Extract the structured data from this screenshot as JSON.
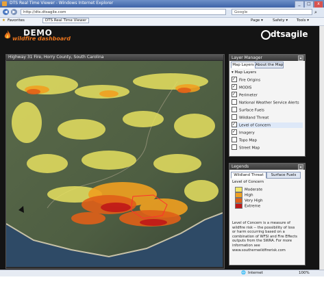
{
  "window": {
    "title": "DTS Real Time Viewer - Windows Internet Explorer",
    "controls": {
      "minimize": "_",
      "maximize": "□",
      "close": "x"
    }
  },
  "browser": {
    "url": "http://dts.dtsagile.com",
    "search_placeholder": "Google",
    "favorites_label": "Favorites",
    "tab_title": "DTS Real Time Viewer",
    "commands": {
      "page": "Page ▾",
      "safety": "Safety ▾",
      "tools": "Tools ▾"
    }
  },
  "app": {
    "logo_title": "DEMO",
    "logo_subtitle": "wildfire dashboard",
    "brand": "dtsagile"
  },
  "map_panel": {
    "title": "Highway 31 Fire, Horry County, South Carolina"
  },
  "layer_manager": {
    "title": "Layer Manager",
    "tabs": [
      "Map Layers",
      "About the Map"
    ],
    "group": "Map Layers",
    "layers": [
      {
        "label": "Fire Origins",
        "checked": true
      },
      {
        "label": "MODIS",
        "checked": true
      },
      {
        "label": "Perimeter",
        "checked": true
      },
      {
        "label": "National Weather Service Alerts",
        "checked": false
      },
      {
        "label": "Surface Fuels",
        "checked": false
      },
      {
        "label": "Wildland Threat",
        "checked": false
      },
      {
        "label": "Level of Concern",
        "checked": true
      },
      {
        "label": "Imagery",
        "checked": true
      },
      {
        "label": "Topo Map",
        "checked": false
      },
      {
        "label": "Street Map",
        "checked": false
      }
    ]
  },
  "legends": {
    "title": "Legends",
    "tabs": [
      "Wildland Threat",
      "Surface Fuels"
    ],
    "heading": "Level of Concern",
    "items": [
      {
        "label": "Moderate",
        "color": "#f2e86a"
      },
      {
        "label": "High",
        "color": "#f0a020"
      },
      {
        "label": "Very High",
        "color": "#e06018"
      },
      {
        "label": "Extreme",
        "color": "#c01818"
      }
    ],
    "description": "Level of Concern is a measure of wildfire risk -- the possibility of loss or harm occurring based on a combination of WFSI and Fire Effects outputs from the SWRA. For more information see www.southernwildfirerisk.com"
  },
  "status": {
    "zone": "Internet",
    "zoom": "100%"
  },
  "colors": {
    "app_bg": "#141414",
    "accent_orange": "#e8731c",
    "moderate": "#f2e86a",
    "high": "#f0a020",
    "very_high": "#e06018",
    "extreme": "#c01818"
  }
}
